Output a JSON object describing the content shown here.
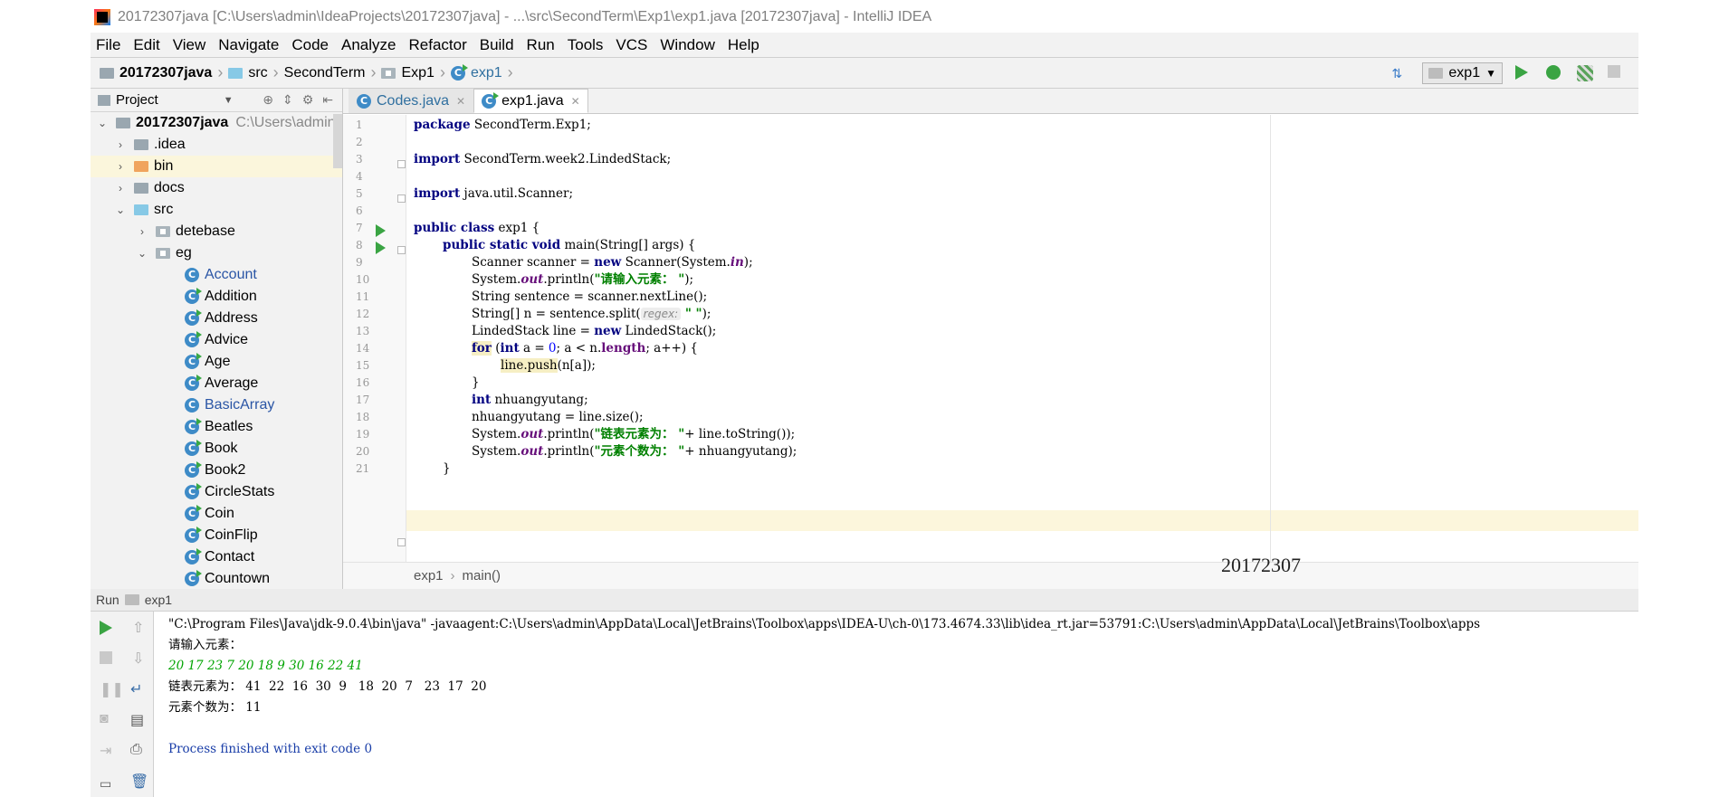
{
  "window": {
    "title": "20172307java [C:\\Users\\admin\\IdeaProjects\\20172307java] - ...\\src\\SecondTerm\\Exp1\\exp1.java [20172307java] - IntelliJ IDEA"
  },
  "menu": [
    "File",
    "Edit",
    "View",
    "Navigate",
    "Code",
    "Analyze",
    "Refactor",
    "Build",
    "Run",
    "Tools",
    "VCS",
    "Window",
    "Help"
  ],
  "navbar": {
    "crumbs": [
      "20172307java",
      "src",
      "SecondTerm",
      "Exp1",
      "exp1"
    ],
    "run_config": "exp1"
  },
  "project": {
    "header": "Project",
    "root_name": "20172307java",
    "root_path": "C:\\Users\\admin\\",
    "items": [
      {
        "label": "Account",
        "blue": true
      },
      {
        "label": "Addition",
        "blue": false
      },
      {
        "label": "Address",
        "blue": false
      },
      {
        "label": "Advice",
        "blue": false
      },
      {
        "label": "Age",
        "blue": false
      },
      {
        "label": "Average",
        "blue": false
      },
      {
        "label": "BasicArray",
        "blue": true
      },
      {
        "label": "Beatles",
        "blue": false
      },
      {
        "label": "Book",
        "blue": false
      },
      {
        "label": "Book2",
        "blue": false
      },
      {
        "label": "CircleStats",
        "blue": false
      },
      {
        "label": "Coin",
        "blue": false
      },
      {
        "label": "CoinFlip",
        "blue": false
      },
      {
        "label": "Contact",
        "blue": false
      },
      {
        "label": "Countown",
        "blue": false
      }
    ],
    "folders": {
      "idea": ".idea",
      "bin": "bin",
      "docs": "docs",
      "src": "src",
      "detebase": "detebase",
      "eg": "eg"
    }
  },
  "tabs": [
    {
      "name": "Codes.java",
      "active": false
    },
    {
      "name": "exp1.java",
      "active": true
    }
  ],
  "code": {
    "line_numbers": [
      "1",
      "2",
      "3",
      "4",
      "5",
      "6",
      "7",
      "8",
      "9",
      "10",
      "11",
      "12",
      "13",
      "14",
      "15",
      "16",
      "17",
      "18",
      "19",
      "20",
      "21"
    ],
    "l1_kw": "package",
    "l1_rest": " SecondTerm.Exp1;",
    "l3_kw": "import",
    "l3_rest": " SecondTerm.week2.LindedStack;",
    "l5_kw": "import",
    "l5_rest": " java.util.Scanner;",
    "l7_kw": "public class",
    "l7_rest": " exp1 {",
    "l8_kw": "public static void",
    "l8_rest": " main(String[] args) {",
    "l9_a": "Scanner scanner = ",
    "l9_kw": "new",
    "l9_b": " Scanner(System.",
    "l9_fld": "in",
    "l9_c": ");",
    "l10_a": "System.",
    "l10_fld": "out",
    "l10_b": ".println(",
    "l10_str": "\"请输入元素： \"",
    "l10_c": ");",
    "l11": "String sentence = scanner.nextLine();",
    "l12_a": "String[] n = sentence.split(",
    "l12_hint": "regex:",
    "l12_str": " \" \"",
    "l12_c": ");",
    "l13_a": "LindedStack line = ",
    "l13_kw": "new",
    "l13_b": " LindedStack();",
    "l14_kw": "for",
    "l14_a": " (",
    "l14_kw2": "int",
    "l14_b": " a = ",
    "l14_num": "0",
    "l14_c": "; a < n.",
    "l14_fld": "length",
    "l14_d": "; a++) {",
    "l15_var": "line.push",
    "l15_rest": "(n[a]);",
    "l16": "}",
    "l17_kw": "int",
    "l17_rest": " nhuangyutang;",
    "l18": "nhuangyutang = line.size();",
    "l19_a": "System.",
    "l19_fld": "out",
    "l19_b": ".println(",
    "l19_str": "\"链表元素为： \"",
    "l19_c": "+ line.toString());",
    "l20_a": "System.",
    "l20_fld": "out",
    "l20_b": ".println(",
    "l20_str": "\"元素个数为： \"",
    "l20_c": "+ nhuangyutang);",
    "l21": "}"
  },
  "editor_breadcrumb": [
    "exp1",
    "main()"
  ],
  "watermark": "20172307",
  "run": {
    "label": "Run",
    "config": "exp1",
    "console": {
      "cmd": "\"C:\\Program Files\\Java\\jdk-9.0.4\\bin\\java\" -javaagent:C:\\Users\\admin\\AppData\\Local\\JetBrains\\Toolbox\\apps\\IDEA-U\\ch-0\\173.4674.33\\lib\\idea_rt.jar=53791:C:\\Users\\admin\\AppData\\Local\\JetBrains\\Toolbox\\apps",
      "prompt": "请输入元素：",
      "input": "20 17 23 7 20 18 9 30 16 22 41",
      "list_output": "链表元素为： 41  22  16  30  9   18  20  7   23  17  20",
      "count_output": "元素个数为： 11",
      "exit": "Process finished with exit code 0"
    }
  },
  "colors": {
    "keyword": "#000080",
    "string": "#008000",
    "run_green": "#3aa443",
    "current_line": "#fcf6dc"
  }
}
